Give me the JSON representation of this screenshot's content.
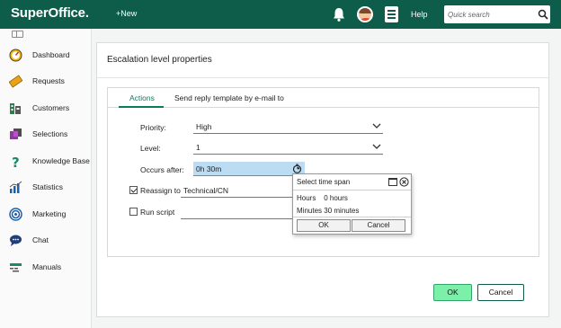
{
  "topbar": {
    "logo": "SuperOffice.",
    "new_label": "+New",
    "help_label": "Help",
    "search_placeholder": "Quick search",
    "bg_color": "#0e5c4a"
  },
  "sidebar": {
    "items": [
      {
        "label": "Dashboard",
        "icon": "speedometer-icon"
      },
      {
        "label": "Requests",
        "icon": "ticket-icon"
      },
      {
        "label": "Customers",
        "icon": "buildings-icon"
      },
      {
        "label": "Selections",
        "icon": "selection-icon"
      },
      {
        "label": "Knowledge Base",
        "icon": "question-icon"
      },
      {
        "label": "Statistics",
        "icon": "bar-chart-icon"
      },
      {
        "label": "Marketing",
        "icon": "target-icon"
      },
      {
        "label": "Chat",
        "icon": "chat-icon"
      },
      {
        "label": "Manuals",
        "icon": "manual-icon"
      }
    ]
  },
  "dialog": {
    "title": "Escalation level properties",
    "tabs": [
      "Actions",
      "Send reply template by e-mail to"
    ],
    "active_tab": "Actions",
    "form": {
      "priority_label": "Priority:",
      "priority_value": "High",
      "level_label": "Level:",
      "level_value": "1",
      "occurs_label": "Occurs after:",
      "occurs_value": "0h 30m",
      "reassign_label": "Reassign to",
      "reassign_checked": true,
      "reassign_value": "Technical/CN",
      "runscript_label": "Run script",
      "runscript_checked": false
    },
    "ok_label": "OK",
    "cancel_label": "Cancel"
  },
  "timespan_popup": {
    "title": "Select time span",
    "hours_label": "Hours",
    "hours_value": "0 hours",
    "minutes_label": "Minutes",
    "minutes_value": "30 minutes",
    "ok_label": "OK",
    "cancel_label": "Cancel"
  },
  "colors": {
    "accent": "#0e7a5c",
    "ok_button": "#7cf0a8",
    "highlight_field": "#bcdcf4"
  }
}
